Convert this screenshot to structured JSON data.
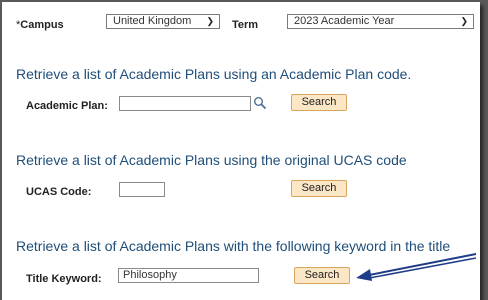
{
  "header": {
    "campus_required": "*",
    "campus_label": "Campus",
    "campus_value": "United Kingdom",
    "term_label": "Term",
    "term_value": "2023 Academic Year"
  },
  "sections": {
    "plan": {
      "heading": "Retrieve a list of Academic Plans using an Academic Plan code.",
      "label": "Academic Plan:",
      "value": "",
      "button": "Search"
    },
    "ucas": {
      "heading": "Retrieve a list of Academic Plans using the original UCAS code",
      "label": "UCAS Code:",
      "value": "",
      "button": "Search"
    },
    "keyword": {
      "heading": "Retrieve a list of Academic Plans with the following keyword in the title",
      "label": "Title Keyword:",
      "value": "Philosophy",
      "button": "Search"
    }
  },
  "icons": {
    "lookup": "search-icon",
    "dropdown": "chevron-down-icon",
    "annotation": "arrow-icon"
  },
  "colors": {
    "heading": "#1f4e79",
    "button_bg": "#fbe6c6",
    "button_border": "#d9a55c",
    "arrow": "#1f3c88"
  }
}
